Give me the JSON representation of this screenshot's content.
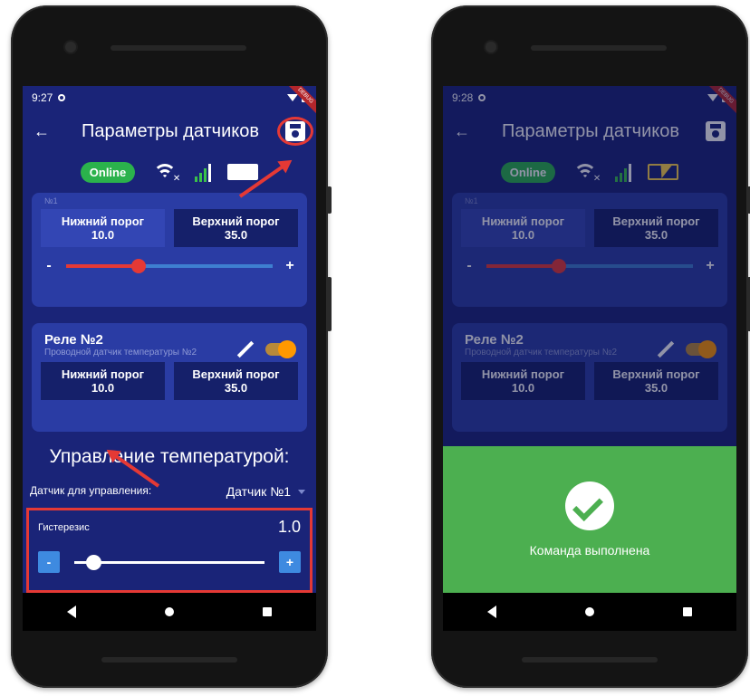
{
  "left": {
    "time": "9:27",
    "title": "Параметры датчиков",
    "online": "Online",
    "card1": {
      "label": "№1",
      "low_label": "Нижний порог",
      "low_value": "10.0",
      "high_label": "Верхний порог",
      "high_value": "35.0",
      "minus": "-",
      "plus": "+",
      "slider_fraction": 0.35
    },
    "card2": {
      "title": "Реле №2",
      "subtitle": "Проводной датчик температуры №2",
      "low_label": "Нижний порог",
      "low_value": "10.0",
      "high_label": "Верхний порог",
      "high_value": "35.0"
    },
    "section_title": "Управление температурой:",
    "control": {
      "label": "Датчик для управления:",
      "value": "Датчик №1"
    },
    "hysteresis": {
      "label": "Гистерезис",
      "value": "1.0",
      "minus": "-",
      "plus": "+"
    }
  },
  "right": {
    "time": "9:28",
    "title": "Параметры датчиков",
    "online": "Online",
    "card1": {
      "label": "№1",
      "low_label": "Нижний порог",
      "low_value": "10.0",
      "high_label": "Верхний порог",
      "high_value": "35.0",
      "minus": "-",
      "plus": "+"
    },
    "card2": {
      "title": "Реле №2",
      "subtitle": "Проводной датчик температуры №2",
      "low_label": "Нижний порог",
      "low_value": "10.0",
      "high_label": "Верхний порог",
      "high_value": "35.0"
    },
    "toast": "Команда выполнена"
  },
  "colors": {
    "screen_bg": "#1a2478",
    "card_bg": "#2a3ca4",
    "accent_red": "#e53935",
    "online_green": "#2bb24c",
    "success_green": "#4caf50",
    "toggle_orange": "#ff9800"
  },
  "icons": [
    "back-arrow-icon",
    "save-icon",
    "wifi-off-icon",
    "signal-icon",
    "battery-icon",
    "pencil-icon",
    "check-icon"
  ]
}
